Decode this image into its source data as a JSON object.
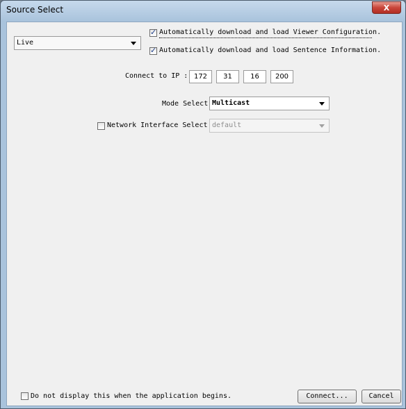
{
  "window": {
    "title": "Source Select",
    "close_label": "X"
  },
  "source": {
    "selected": "Live"
  },
  "options": {
    "auto_viewer_config": {
      "label": "Automatically download and load Viewer Configuration.",
      "checked": true
    },
    "auto_sentence_info": {
      "label": "Automatically download and load Sentence Information.",
      "checked": true
    }
  },
  "connect_ip": {
    "label": "Connect to IP :",
    "octets": [
      "172",
      "31",
      "16",
      "200"
    ]
  },
  "mode": {
    "label": "Mode Select",
    "selected": "Multicast"
  },
  "network_interface": {
    "label": "Network Interface Select",
    "checked": false,
    "selected": "default"
  },
  "footer": {
    "startup_label": "Do not display this when the application begins.",
    "startup_checked": false,
    "connect_label": "Connect...",
    "cancel_label": "Cancel"
  }
}
